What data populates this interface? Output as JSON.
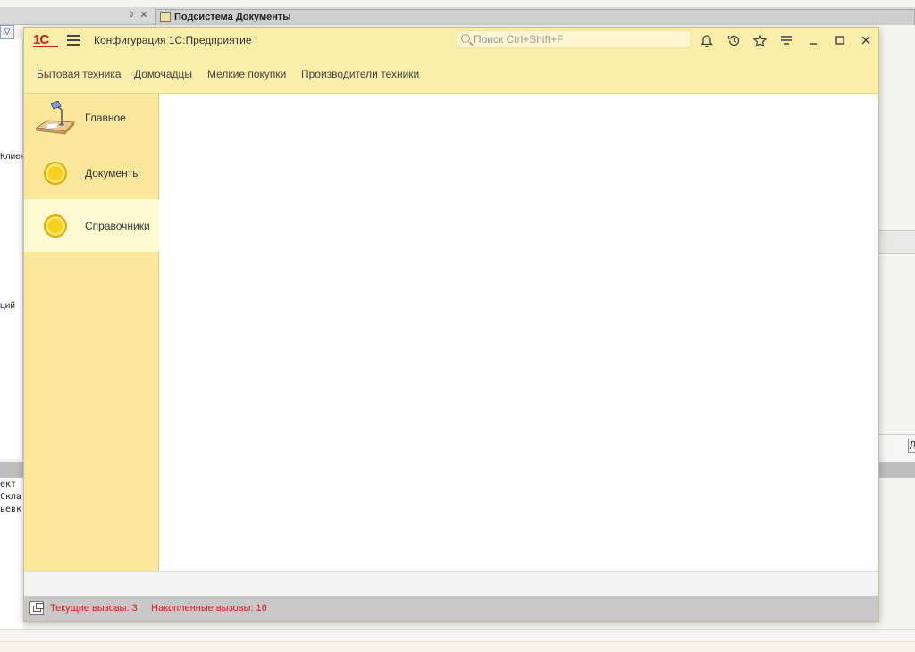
{
  "background": {
    "tab_controls": [
      "ᵍ",
      "✕"
    ],
    "tab_title": "Подсистема Документы",
    "left_labels": [
      "Клиен",
      "ций"
    ],
    "lower_lines": [
      "ект",
      "Скла",
      "ьевк"
    ],
    "right_button": "Д"
  },
  "app": {
    "logo": "1С",
    "title": "Конфигурация 1С:Предприятие",
    "search_placeholder": "Поиск Ctrl+Shift+F",
    "toolbar_icons": [
      "bell-icon",
      "history-icon",
      "star-icon",
      "menu-more-icon",
      "minimize-icon",
      "maximize-icon",
      "close-icon"
    ]
  },
  "nav": {
    "links": [
      "Бытовая техника",
      "Домочадцы",
      "Мелкие покупки",
      "Производители техники"
    ]
  },
  "sections": [
    {
      "label": "Главное",
      "icon": "desk-lamp-icon",
      "active": false
    },
    {
      "label": "Документы",
      "icon": "coin-icon",
      "active": false
    },
    {
      "label": "Справочники",
      "icon": "coin-icon",
      "active": true
    }
  ],
  "status": {
    "current_calls": "Текущие вызовы: 3",
    "accumulated_calls": "Накопленные вызовы: 16"
  },
  "colors": {
    "panel_yellow": "#fbedaa",
    "sections_yellow": "#fbe79a",
    "active_section": "#fdfad2",
    "logo_red": "#d41e1e",
    "status_red": "#e01818"
  }
}
